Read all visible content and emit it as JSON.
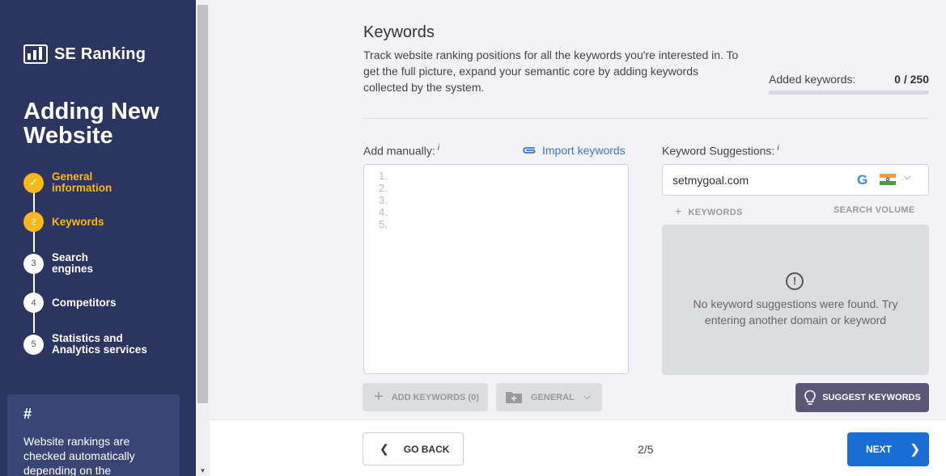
{
  "brand": {
    "name": "SE Ranking"
  },
  "sidebar": {
    "title": "Adding New Website",
    "steps": [
      {
        "number": "✓",
        "label": "General information",
        "state": "done"
      },
      {
        "number": "2",
        "label": "Keywords",
        "state": "active"
      },
      {
        "number": "3",
        "label": "Search engines",
        "state": "pending"
      },
      {
        "number": "4",
        "label": "Competitors",
        "state": "pending"
      },
      {
        "number": "5",
        "label": "Statistics and Analytics services",
        "state": "pending"
      }
    ],
    "info": {
      "symbol": "#",
      "text": "Website rankings are checked automatically depending on the"
    }
  },
  "main": {
    "title": "Keywords",
    "description": "Track website ranking positions for all the keywords you're interested in. To get the full picture, expand your semantic core by adding keywords collected by the system.",
    "added": {
      "label": "Added keywords:",
      "count": "0 / 250",
      "progress": 0
    },
    "manual": {
      "label": "Add manually:",
      "info_icon": "i",
      "import_label": "Import keywords",
      "line_numbers": [
        "1.",
        "2.",
        "3.",
        "4.",
        "5."
      ],
      "add_button": "ADD KEYWORDS (0)",
      "group_button": "GENERAL"
    },
    "suggestions": {
      "label": "Keyword Suggestions:",
      "info_icon": "i",
      "domain": "setmygoal.com",
      "engine_icon": "google-icon",
      "country_flag": "india-flag",
      "col_keywords": "KEYWORDS",
      "col_volume": "SEARCH VOLUME",
      "empty_text": "No keyword suggestions were found. Try entering another domain or keyword",
      "suggest_button": "SUGGEST KEYWORDS"
    }
  },
  "footer": {
    "back": "GO BACK",
    "page": "2/5",
    "next": "NEXT"
  },
  "colors": {
    "sidebar_bg": "#2c3560",
    "accent": "#f9b719",
    "primary": "#1a6dd4",
    "link": "#3a78c9",
    "suggest_btn": "#5b5776"
  }
}
